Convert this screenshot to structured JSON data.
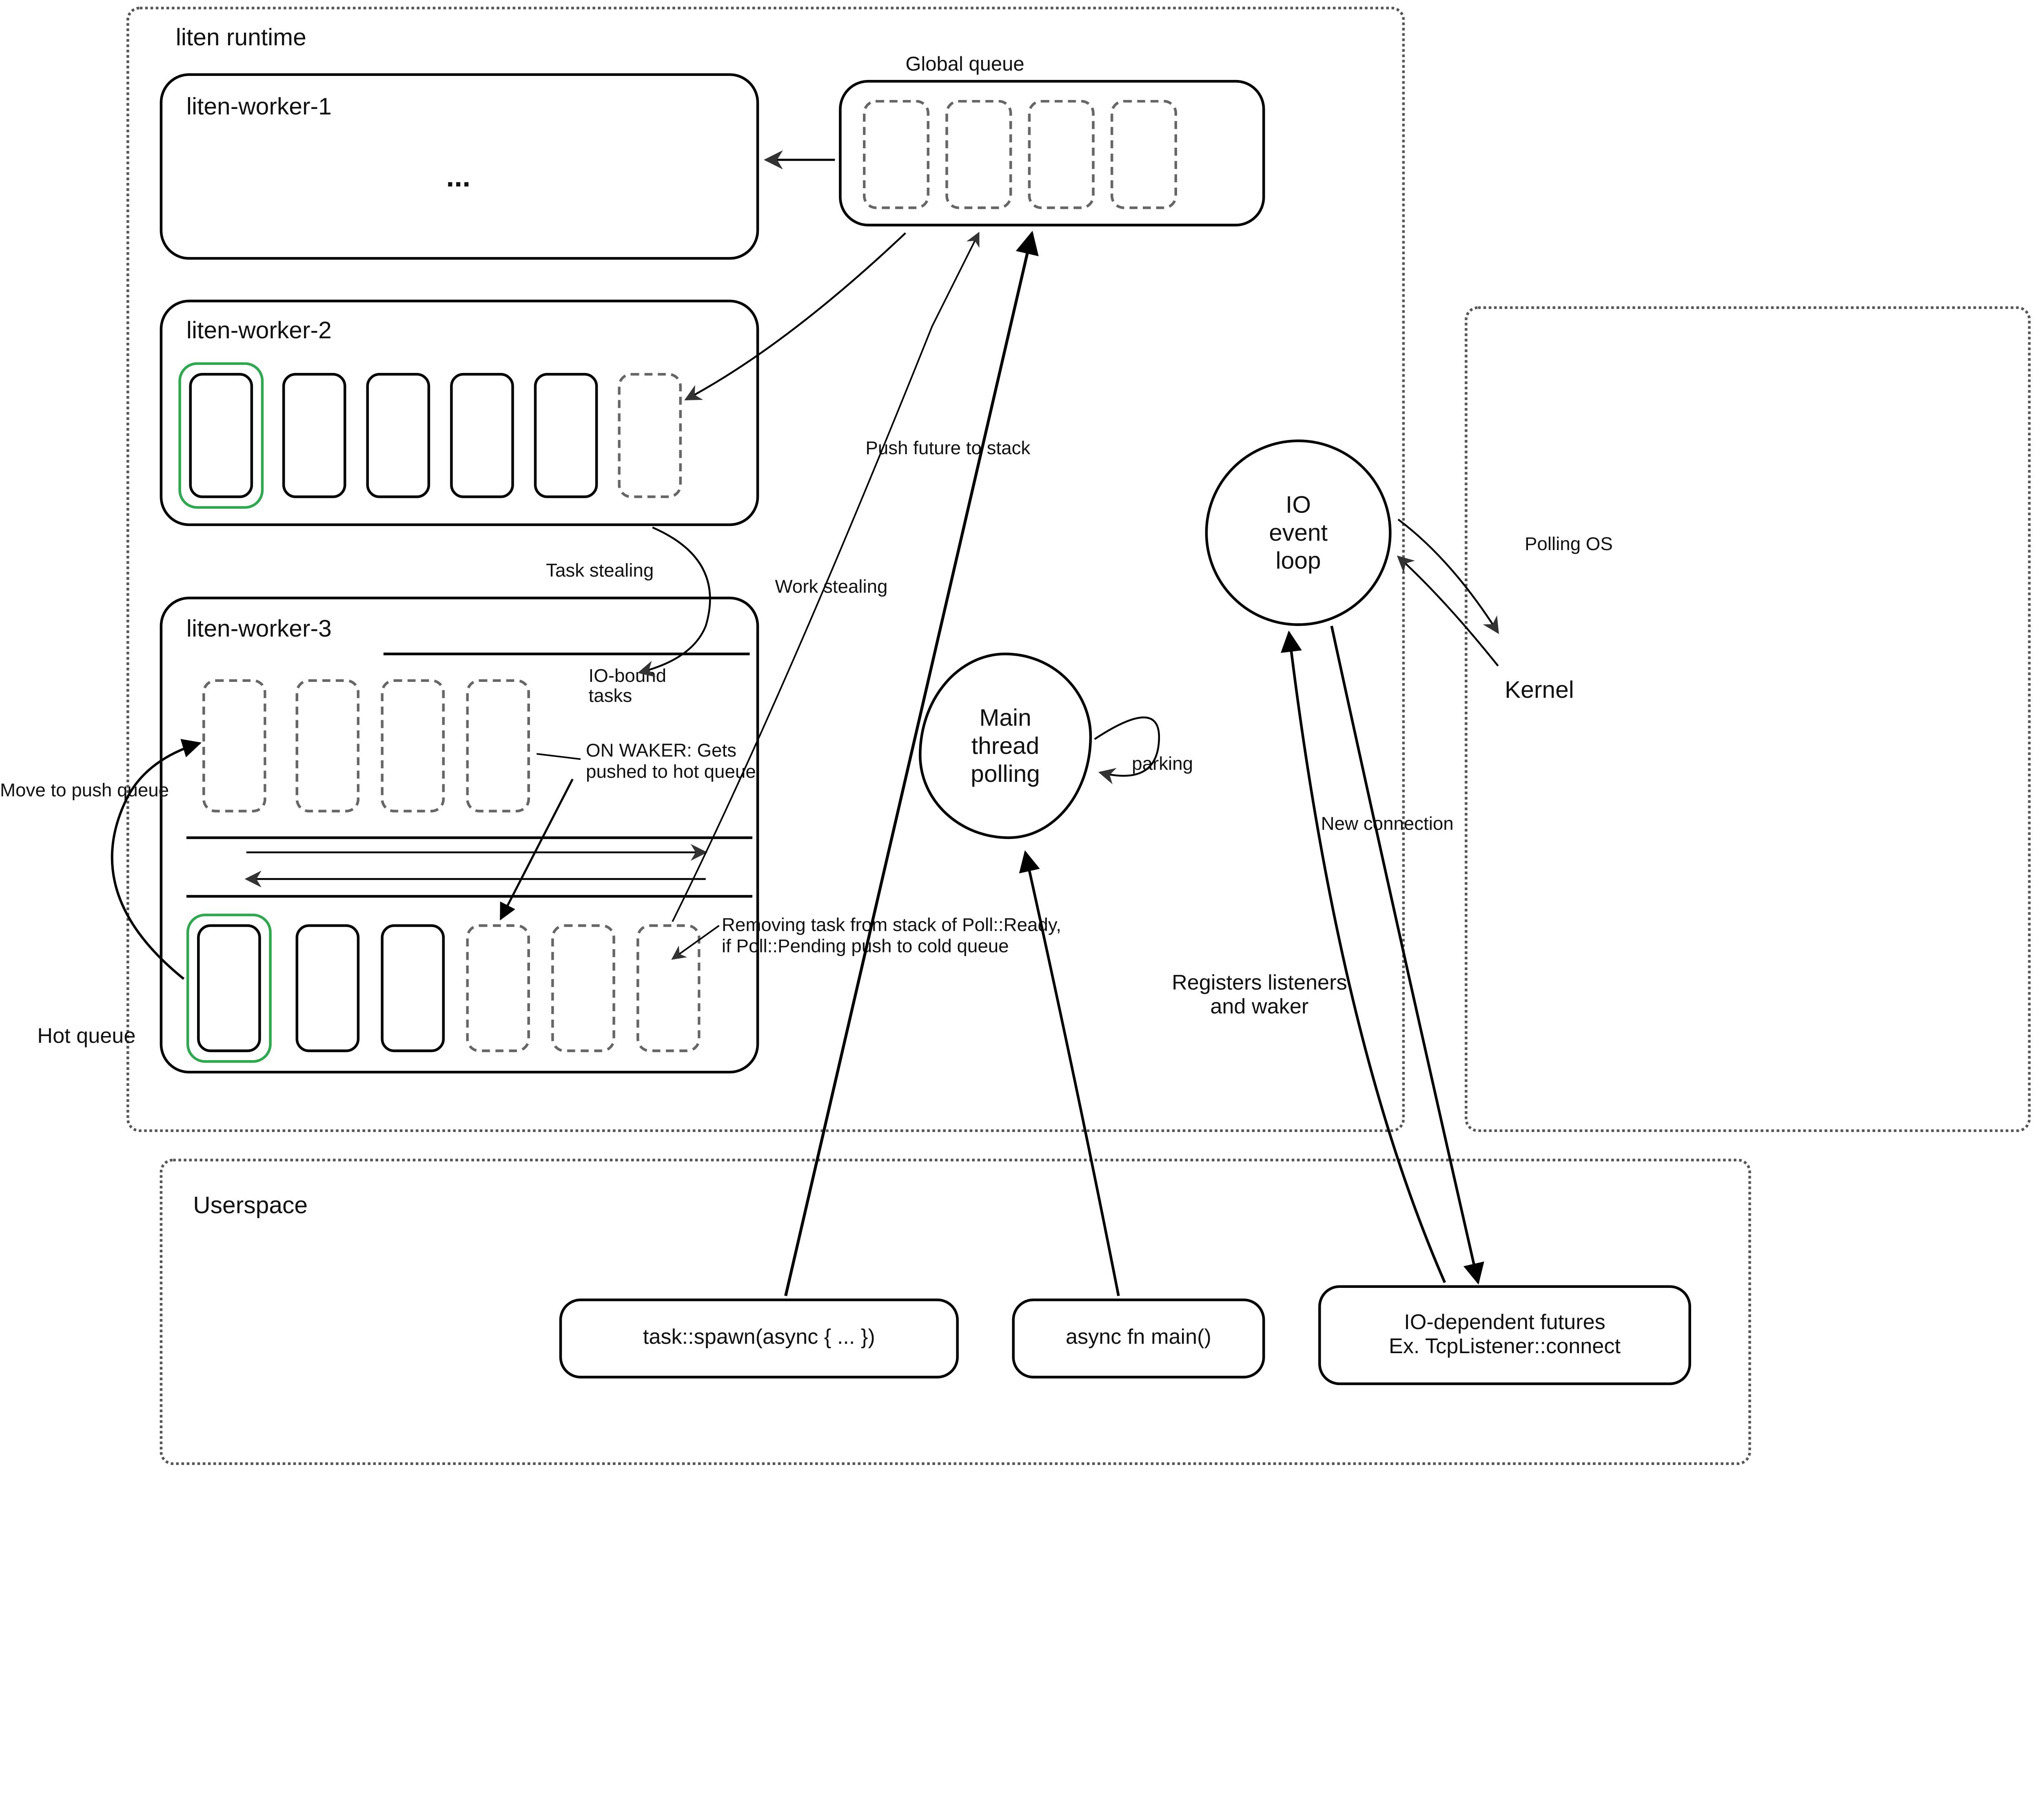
{
  "runtime": {
    "title": "liten runtime",
    "worker1": {
      "title": "liten-worker-1",
      "ellipsis": "..."
    },
    "worker2": {
      "title": "liten-worker-2"
    },
    "worker3": {
      "title": "liten-worker-3",
      "io_bound_label": "IO-bound\ntasks",
      "on_waker_label": "ON WAKER: Gets\npushed to hot queue",
      "removing_label": "Removing task from stack of Poll::Ready,\nif Poll::Pending push to cold queue"
    },
    "task_stealing_label": "Task stealing",
    "work_stealing_label": "Work stealing",
    "push_future_label": "Push future to stack",
    "hot_queue_label": "Hot queue",
    "move_push_label": "Move to push queue",
    "global_queue_label": "Global queue"
  },
  "io_loop": {
    "label": "IO\nevent\nloop",
    "polling_os_label": "Polling OS",
    "new_connection_label": "New connection",
    "registers_label": "Registers listeners\nand waker"
  },
  "main_thread": {
    "label": "Main\nthread\npolling",
    "parking_label": "parking"
  },
  "kernel": {
    "label": "Kernel"
  },
  "userspace": {
    "title": "Userspace",
    "spawn_label": "task::spawn(async { ... })",
    "main_label": "async fn main()",
    "io_dep_label": "IO-dependent futures\nEx. TcpListener::connect"
  }
}
